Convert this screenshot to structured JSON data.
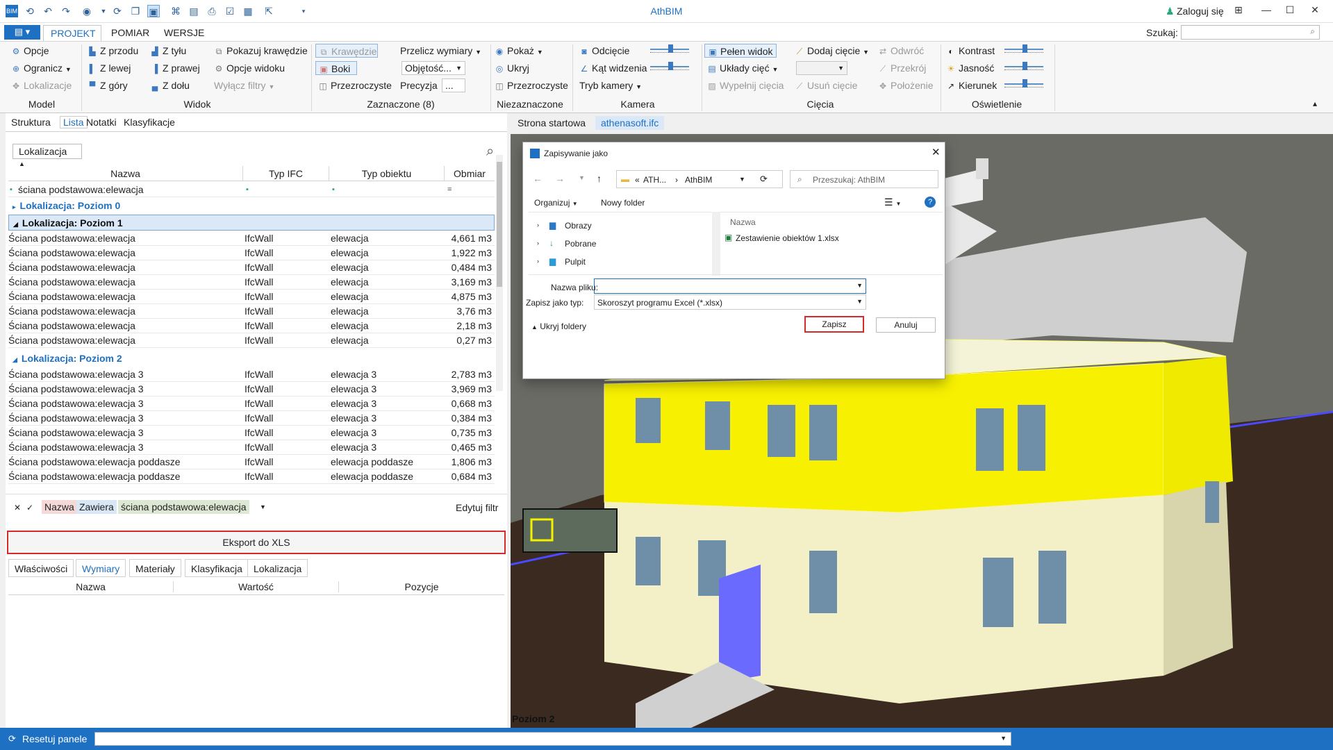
{
  "app": {
    "title": "AthBIM",
    "login": "Zaloguj się",
    "search_label": "Szukaj:"
  },
  "tabs": [
    "PROJEKT",
    "POMIAR",
    "WERSJE"
  ],
  "ribbon": {
    "model": {
      "label": "Model",
      "items": [
        "Opcje",
        "Ogranicz",
        "Lokalizacje"
      ]
    },
    "widok": {
      "label": "Widok",
      "items": [
        "Z przodu",
        "Z tyłu",
        "Z lewej",
        "Z prawej",
        "Z góry",
        "Z dołu",
        "Pokazuj krawędzie",
        "Opcje widoku",
        "Wyłącz filtry"
      ]
    },
    "zaznaczone": {
      "label": "Zaznaczone (8)",
      "items": [
        "Krawędzie",
        "Boki",
        "Przezroczyste",
        "Przelicz wymiary",
        "Objętość...",
        "Precyzja",
        "..."
      ]
    },
    "niezaznaczone": {
      "label": "Niezaznaczone",
      "items": [
        "Pokaż",
        "Ukryj",
        "Przezroczyste"
      ]
    },
    "kamera": {
      "label": "Kamera",
      "items": [
        "Odcięcie",
        "Kąt widzenia",
        "Tryb kamery"
      ]
    },
    "ciecia": {
      "label": "Cięcia",
      "items": [
        "Pełen widok",
        "Układy cięć",
        "Wypełnij cięcia",
        "Dodaj cięcie",
        "Usuń cięcie",
        "Odwróć",
        "Przekrój",
        "Położenie"
      ]
    },
    "oswietlenie": {
      "label": "Oświetlenie",
      "items": [
        "Kontrast",
        "Jasność",
        "Kierunek"
      ]
    }
  },
  "left": {
    "tabs": [
      "Struktura",
      "Lista",
      "Notatki",
      "Klasyfikacje"
    ],
    "groupby": "Lokalizacja",
    "columns": [
      "Nazwa",
      "Typ IFC",
      "Typ obiektu",
      "Obmiar"
    ],
    "filter_row": "ściana podstawowa:elewacja",
    "groups": [
      "Lokalizacja: Poziom 0",
      "Lokalizacja: Poziom 1",
      "Lokalizacja: Poziom 2"
    ],
    "rows1": [
      [
        "Ściana podstawowa:elewacja",
        "IfcWall",
        "elewacja",
        "4,661 m3"
      ],
      [
        "Ściana podstawowa:elewacja",
        "IfcWall",
        "elewacja",
        "1,922 m3"
      ],
      [
        "Ściana podstawowa:elewacja",
        "IfcWall",
        "elewacja",
        "0,484 m3"
      ],
      [
        "Ściana podstawowa:elewacja",
        "IfcWall",
        "elewacja",
        "3,169 m3"
      ],
      [
        "Ściana podstawowa:elewacja",
        "IfcWall",
        "elewacja",
        "4,875 m3"
      ],
      [
        "Ściana podstawowa:elewacja",
        "IfcWall",
        "elewacja",
        "3,76 m3"
      ],
      [
        "Ściana podstawowa:elewacja",
        "IfcWall",
        "elewacja",
        "2,18 m3"
      ],
      [
        "Ściana podstawowa:elewacja",
        "IfcWall",
        "elewacja",
        "0,27 m3"
      ]
    ],
    "rows2": [
      [
        "Ściana podstawowa:elewacja 3",
        "IfcWall",
        "elewacja 3",
        "2,783 m3"
      ],
      [
        "Ściana podstawowa:elewacja 3",
        "IfcWall",
        "elewacja 3",
        "3,969 m3"
      ],
      [
        "Ściana podstawowa:elewacja 3",
        "IfcWall",
        "elewacja 3",
        "0,668 m3"
      ],
      [
        "Ściana podstawowa:elewacja 3",
        "IfcWall",
        "elewacja 3",
        "0,384 m3"
      ],
      [
        "Ściana podstawowa:elewacja 3",
        "IfcWall",
        "elewacja 3",
        "0,735 m3"
      ],
      [
        "Ściana podstawowa:elewacja 3",
        "IfcWall",
        "elewacja 3",
        "0,465 m3"
      ],
      [
        "Ściana podstawowa:elewacja poddasze",
        "IfcWall",
        "elewacja poddasze",
        "1,806 m3"
      ],
      [
        "Ściana podstawowa:elewacja poddasze",
        "IfcWall",
        "elewacja poddasze",
        "0,684 m3"
      ]
    ],
    "filter_chips": [
      "Nazwa",
      "Zawiera",
      "ściana podstawowa:elewacja"
    ],
    "edit_filter": "Edytuj filtr",
    "export": "Eksport do XLS",
    "bottom_tabs": [
      "Właściwości",
      "Wymiary",
      "Materiały",
      "Klasyfikacja",
      "Lokalizacja"
    ],
    "bottom_columns": [
      "Nazwa",
      "Wartość",
      "Pozycje"
    ]
  },
  "view_tabs": [
    "Strona startowa",
    "athenasoft.ifc"
  ],
  "level_label": "Poziom 2",
  "dialog": {
    "title": "Zapisywanie jako",
    "path1": "ATH...",
    "path2": "AthBIM",
    "search": "Przeszukaj: AthBIM",
    "organize": "Organizuj",
    "new_folder": "Nowy folder",
    "folders": [
      "Obrazy",
      "Pobrane",
      "Pulpit"
    ],
    "col_name": "Nazwa",
    "file": "Zestawienie obiektów 1.xlsx",
    "filename_label": "Nazwa pliku:",
    "type_label": "Zapisz jako typ:",
    "type_value": "Skoroszyt programu Excel (*.xlsx)",
    "hide_folders": "Ukryj foldery",
    "save": "Zapisz",
    "cancel": "Anuluj"
  },
  "status": {
    "reset": "Resetuj panele"
  }
}
